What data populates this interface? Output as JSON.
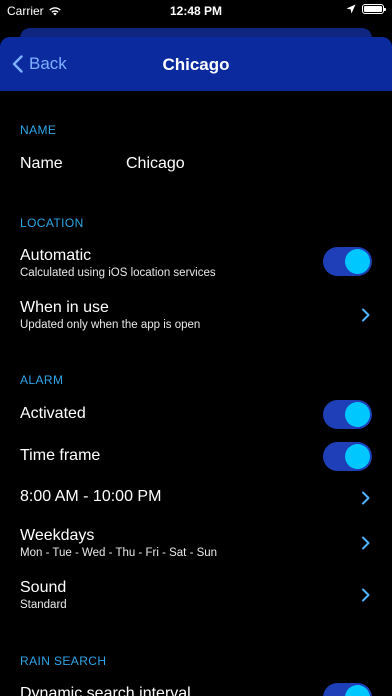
{
  "status_bar": {
    "carrier": "Carrier",
    "time": "12:48 PM"
  },
  "nav": {
    "back_label": "Back",
    "title": "Chicago"
  },
  "sections": {
    "name": {
      "header": "NAME",
      "name_label": "Name",
      "name_value": "Chicago"
    },
    "location": {
      "header": "LOCATION",
      "automatic_label": "Automatic",
      "automatic_sub": "Calculated using iOS location services",
      "automatic_on": true,
      "when_in_use_label": "When in use",
      "when_in_use_sub": "Updated only when the app is open"
    },
    "alarm": {
      "header": "ALARM",
      "activated_label": "Activated",
      "activated_on": true,
      "time_frame_label": "Time frame",
      "time_frame_on": true,
      "time_range": "8:00 AM - 10:00 PM",
      "weekdays_label": "Weekdays",
      "weekdays_sub": "Mon - Tue - Wed - Thu - Fri - Sat - Sun",
      "sound_label": "Sound",
      "sound_sub": "Standard"
    },
    "rain_search": {
      "header": "RAIN SEARCH",
      "dynamic_label": "Dynamic search interval",
      "dynamic_on": true
    }
  },
  "colors": {
    "nav_background": "#0a2a9e",
    "section_header": "#2fa6e8",
    "toggle_track": "#1e3fb8",
    "toggle_knob": "#00c8ff",
    "chevron": "#4fb4ff"
  }
}
